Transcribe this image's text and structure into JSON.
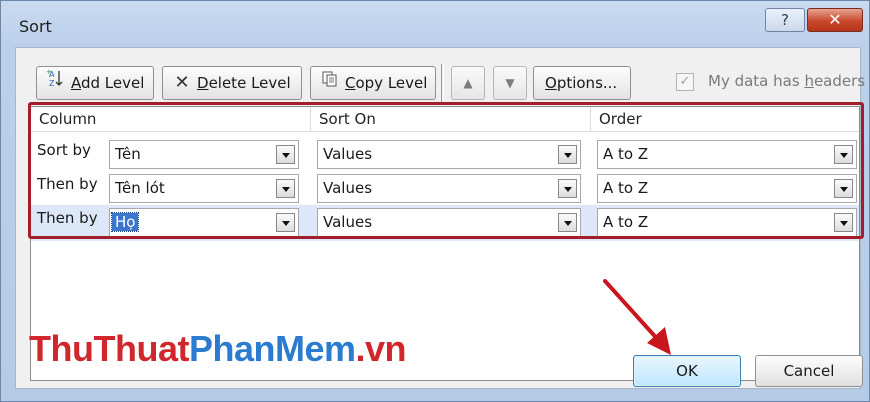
{
  "window": {
    "title": "Sort",
    "help_label": "?",
    "close_label": "✕"
  },
  "toolbar": {
    "add_level": {
      "accel": "A",
      "rest": "dd Level"
    },
    "delete_level": {
      "accel": "D",
      "rest": "elete Level"
    },
    "copy_level": {
      "accel": "C",
      "rest": "opy Level"
    },
    "move_up": "▲",
    "move_down": "▼",
    "options": {
      "accel": "O",
      "rest": "ptions..."
    },
    "my_data_has_headers": {
      "before": "My data has ",
      "accel": "h",
      "after": "eaders"
    },
    "headers_checked": "✓"
  },
  "grid": {
    "headers": {
      "column": "Column",
      "sort_on": "Sort On",
      "order": "Order"
    },
    "rows": [
      {
        "label": "Sort by",
        "column": "Tên",
        "sort_on": "Values",
        "order": "A to Z"
      },
      {
        "label": "Then by",
        "column": "Tên lót",
        "sort_on": "Values",
        "order": "A to Z"
      },
      {
        "label": "Then by",
        "column": "Họ",
        "sort_on": "Values",
        "order": "A to Z"
      }
    ]
  },
  "watermark": {
    "part1": "ThuThuat",
    "part2": "PhanMem",
    "part3": ".vn"
  },
  "buttons": {
    "ok": "OK",
    "cancel": "Cancel"
  },
  "colors": {
    "highlight_box": "#a41d2a",
    "selection": "#3a77cc",
    "arrow": "#c8151e"
  }
}
